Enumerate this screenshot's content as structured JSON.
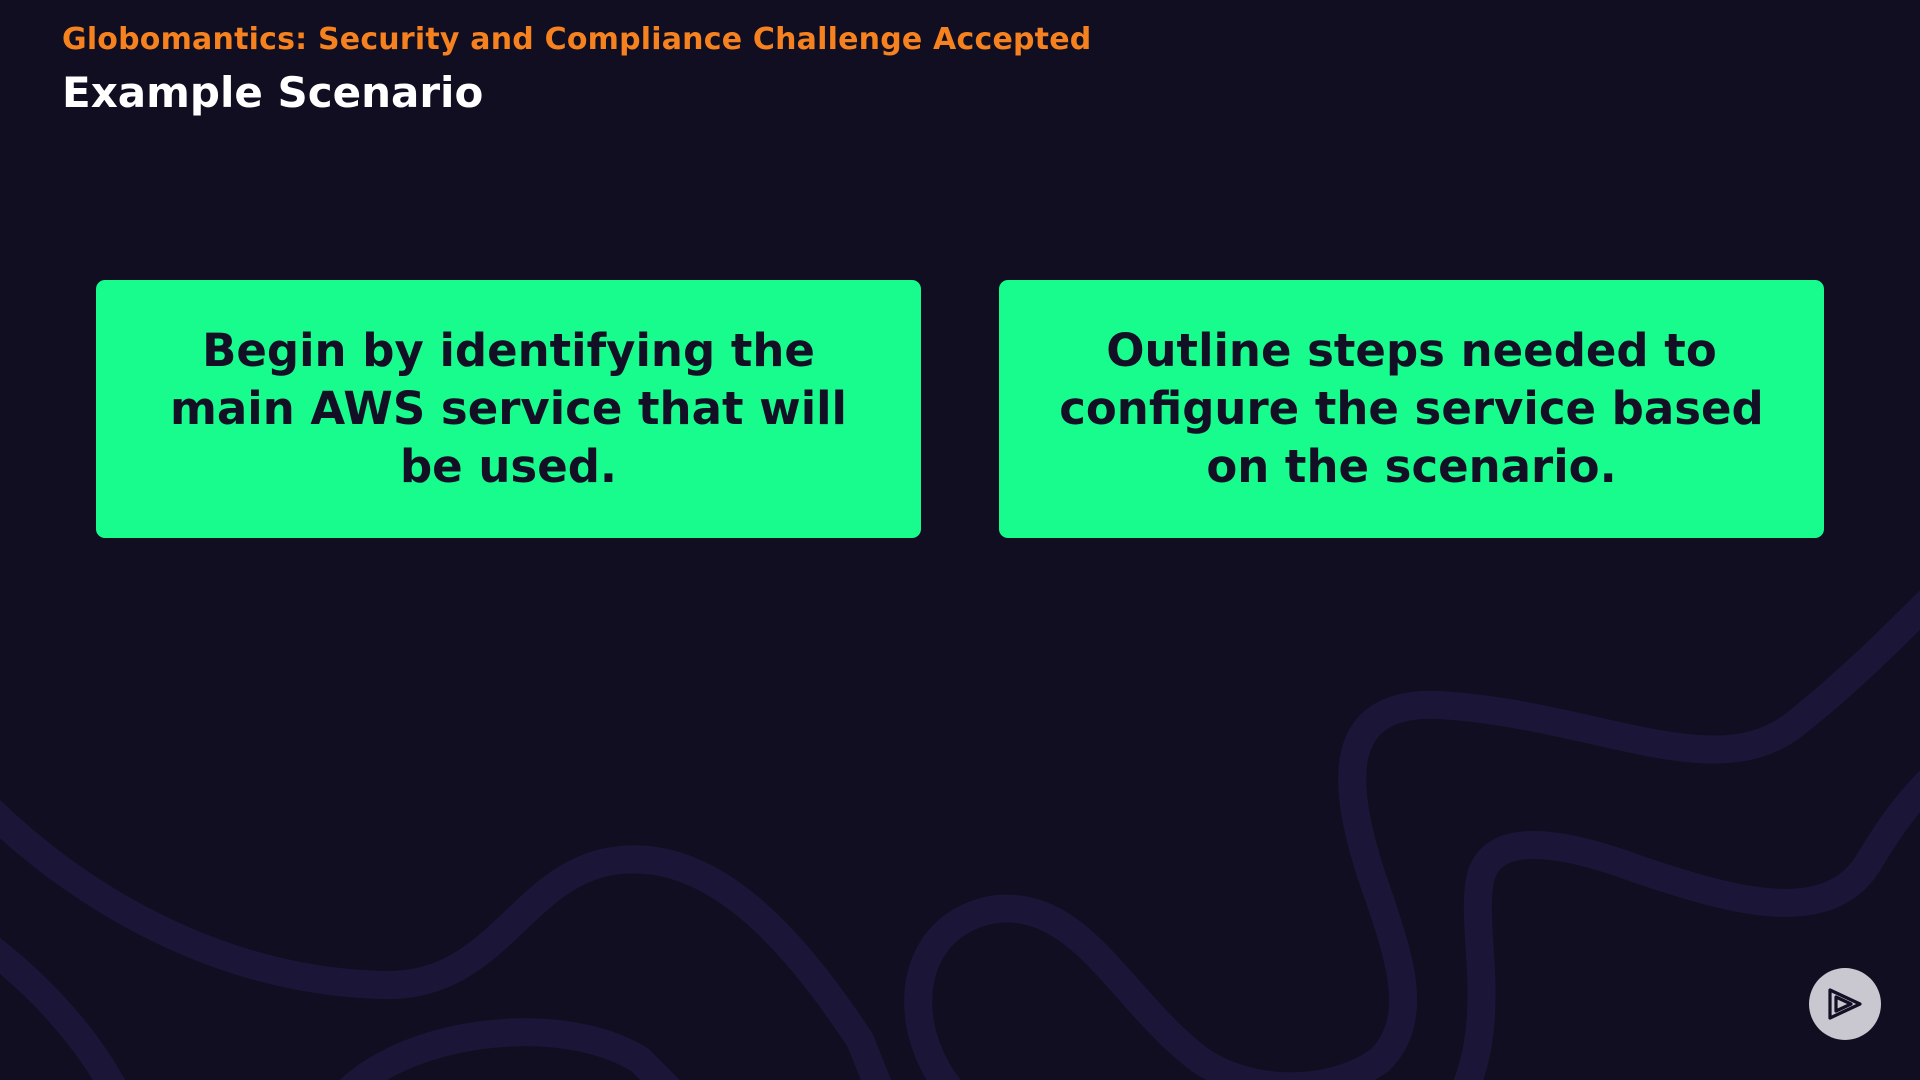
{
  "header": {
    "course_title": "Globomantics: Security and Compliance Challenge Accepted",
    "slide_title": "Example Scenario"
  },
  "cards": [
    {
      "text": "Begin by identifying the main AWS service that will be used."
    },
    {
      "text": "Outline steps needed to configure the service based on the scenario."
    }
  ],
  "branding": {
    "logo_icon": "play-logo-icon"
  },
  "colors": {
    "background": "#110e22",
    "accent_orange": "#f5821f",
    "card_green": "#18fc8d",
    "card_text": "#130f25",
    "decor_lines": "#1b1638"
  }
}
